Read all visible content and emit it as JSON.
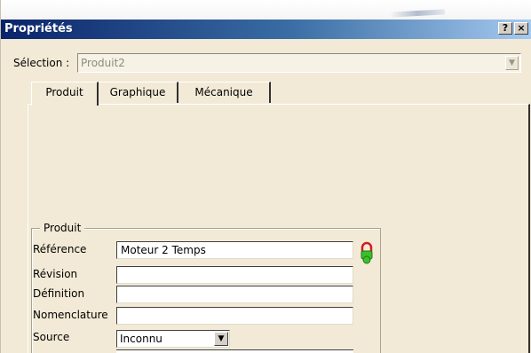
{
  "window": {
    "title": "Propriétés",
    "help_button": "?",
    "close_button": "×"
  },
  "selection": {
    "label": "Sélection :",
    "value": "Produit2"
  },
  "tabs": [
    {
      "label": "Produit",
      "active": true
    },
    {
      "label": "Graphique",
      "active": false
    },
    {
      "label": "Mécanique",
      "active": false
    }
  ],
  "produit_group": {
    "title": "Produit",
    "fields": {
      "reference": {
        "label": "Référence",
        "value": "Moteur 2 Temps"
      },
      "revision": {
        "label": "Révision",
        "value": ""
      },
      "definition": {
        "label": "Définition",
        "value": ""
      },
      "nomenclature": {
        "label": "Nomenclature",
        "value": ""
      },
      "source": {
        "label": "Source",
        "value": "Inconnu"
      }
    },
    "lock_icon": "lock-icon"
  },
  "colors": {
    "titlebar_start": "#0a246a",
    "titlebar_end": "#a6caf0",
    "dialog_bg": "#f2ead6",
    "lock_ring": "#cc2020",
    "lock_body": "#3bbf2a"
  }
}
